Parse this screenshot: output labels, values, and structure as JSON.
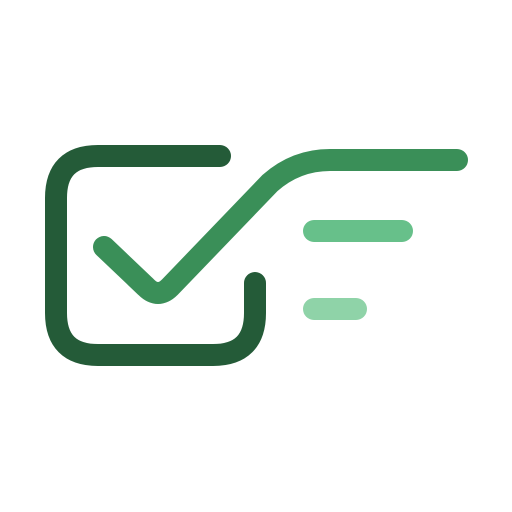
{
  "logo": {
    "icon": "checkbox-check-with-lines-icon",
    "colors": {
      "box": "#245b38",
      "check": "#3a8f58",
      "line_primary": "#67c08a",
      "line_secondary": "#8fd3a8",
      "background": "#ffffff"
    }
  }
}
